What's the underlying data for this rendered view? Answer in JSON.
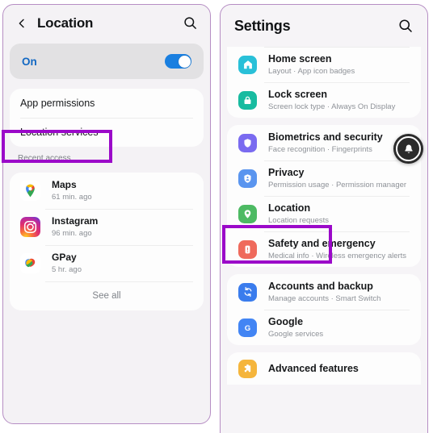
{
  "left_panel": {
    "header": {
      "back_icon": "chevron-left-icon",
      "title": "Location",
      "search_icon": "search-icon"
    },
    "toggle": {
      "state_label": "On",
      "enabled": true,
      "accent": "#1a7fe0",
      "label_color": "#1268c3"
    },
    "menu": [
      {
        "label": "App permissions"
      },
      {
        "label": "Location services",
        "highlighted": true
      }
    ],
    "recent_access_label": "Recent access",
    "recent_apps": [
      {
        "name": "Maps",
        "time": "61 min. ago",
        "icon": "google-maps-icon"
      },
      {
        "name": "Instagram",
        "time": "96 min. ago",
        "icon": "instagram-icon"
      },
      {
        "name": "GPay",
        "time": "5 hr. ago",
        "icon": "gpay-icon"
      }
    ],
    "see_all_label": "See all"
  },
  "right_panel": {
    "header": {
      "title": "Settings",
      "search_icon": "search-icon"
    },
    "bell_bubble": {
      "icon": "bell-icon",
      "background": "#2b2b2b"
    },
    "groups": [
      {
        "items": [
          {
            "title": "Home screen",
            "subtitle": "Layout  ·  App icon badges",
            "icon": "home-icon",
            "icon_color": "#29c0d8"
          },
          {
            "title": "Lock screen",
            "subtitle": "Screen lock type  ·  Always On Display",
            "icon": "lock-icon",
            "icon_color": "#18bba0"
          }
        ]
      },
      {
        "items": [
          {
            "title": "Biometrics and security",
            "subtitle": "Face recognition  ·  Fingerprints",
            "icon": "shield-icon",
            "icon_color": "#7a6bf0"
          },
          {
            "title": "Privacy",
            "subtitle": "Permission usage  ·  Permission manager",
            "icon": "privacy-person-shield-icon",
            "icon_color": "#5a95ef"
          },
          {
            "title": "Location",
            "subtitle": "Location requests",
            "icon": "location-pin-icon",
            "icon_color": "#4dba63",
            "highlighted": true
          },
          {
            "title": "Safety and emergency",
            "subtitle": "Medical info  ·  Wireless emergency alerts",
            "icon": "emergency-alert-icon",
            "icon_color": "#ef6a5c"
          }
        ]
      },
      {
        "items": [
          {
            "title": "Accounts and backup",
            "subtitle": "Manage accounts  ·  Smart Switch",
            "icon": "sync-accounts-icon",
            "icon_color": "#3a7ced"
          },
          {
            "title": "Google",
            "subtitle": "Google services",
            "icon": "google-g-icon",
            "icon_color": "#4285f4"
          }
        ]
      },
      {
        "items": [
          {
            "title": "Advanced features",
            "subtitle": "",
            "icon": "advanced-features-icon",
            "icon_color": "#f5b53c"
          }
        ]
      }
    ]
  },
  "annotation": {
    "highlight_color": "#9b09c9"
  }
}
